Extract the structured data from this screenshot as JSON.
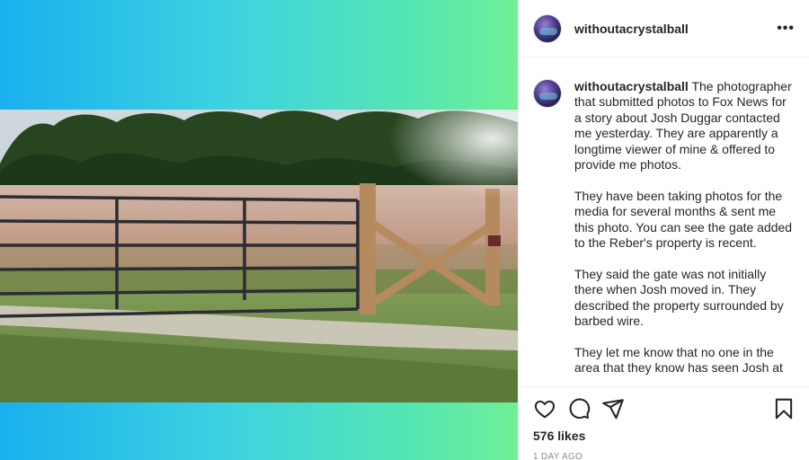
{
  "post": {
    "username": "withoutacrystalball",
    "more_label": "•••",
    "caption": {
      "username": "withoutacrystalball",
      "paragraphs": [
        "The photographer that submitted photos to Fox News for a story about Josh Duggar contacted me yesterday. They are apparently a longtime viewer of mine & offered to provide me photos.",
        "They have been taking photos for the media for several months & sent me this photo. You can see the gate added to the Reber's property is recent.",
        "They said the gate was not initially there when Josh moved in. They described the property surrounded by barbed wire.",
        "They let me know that no one in the area that they know has seen Josh at"
      ]
    },
    "likes": "576 likes",
    "time": "1 DAY AGO"
  },
  "icons": {
    "like": "heart-icon",
    "comment": "speech-bubble-icon",
    "share": "paper-plane-icon",
    "save": "bookmark-icon"
  },
  "colors": {
    "gradient_start": "#1ab0ee",
    "gradient_end": "#6ff096",
    "text": "#262626",
    "muted": "#8e8e8e",
    "divider": "#efefef"
  }
}
